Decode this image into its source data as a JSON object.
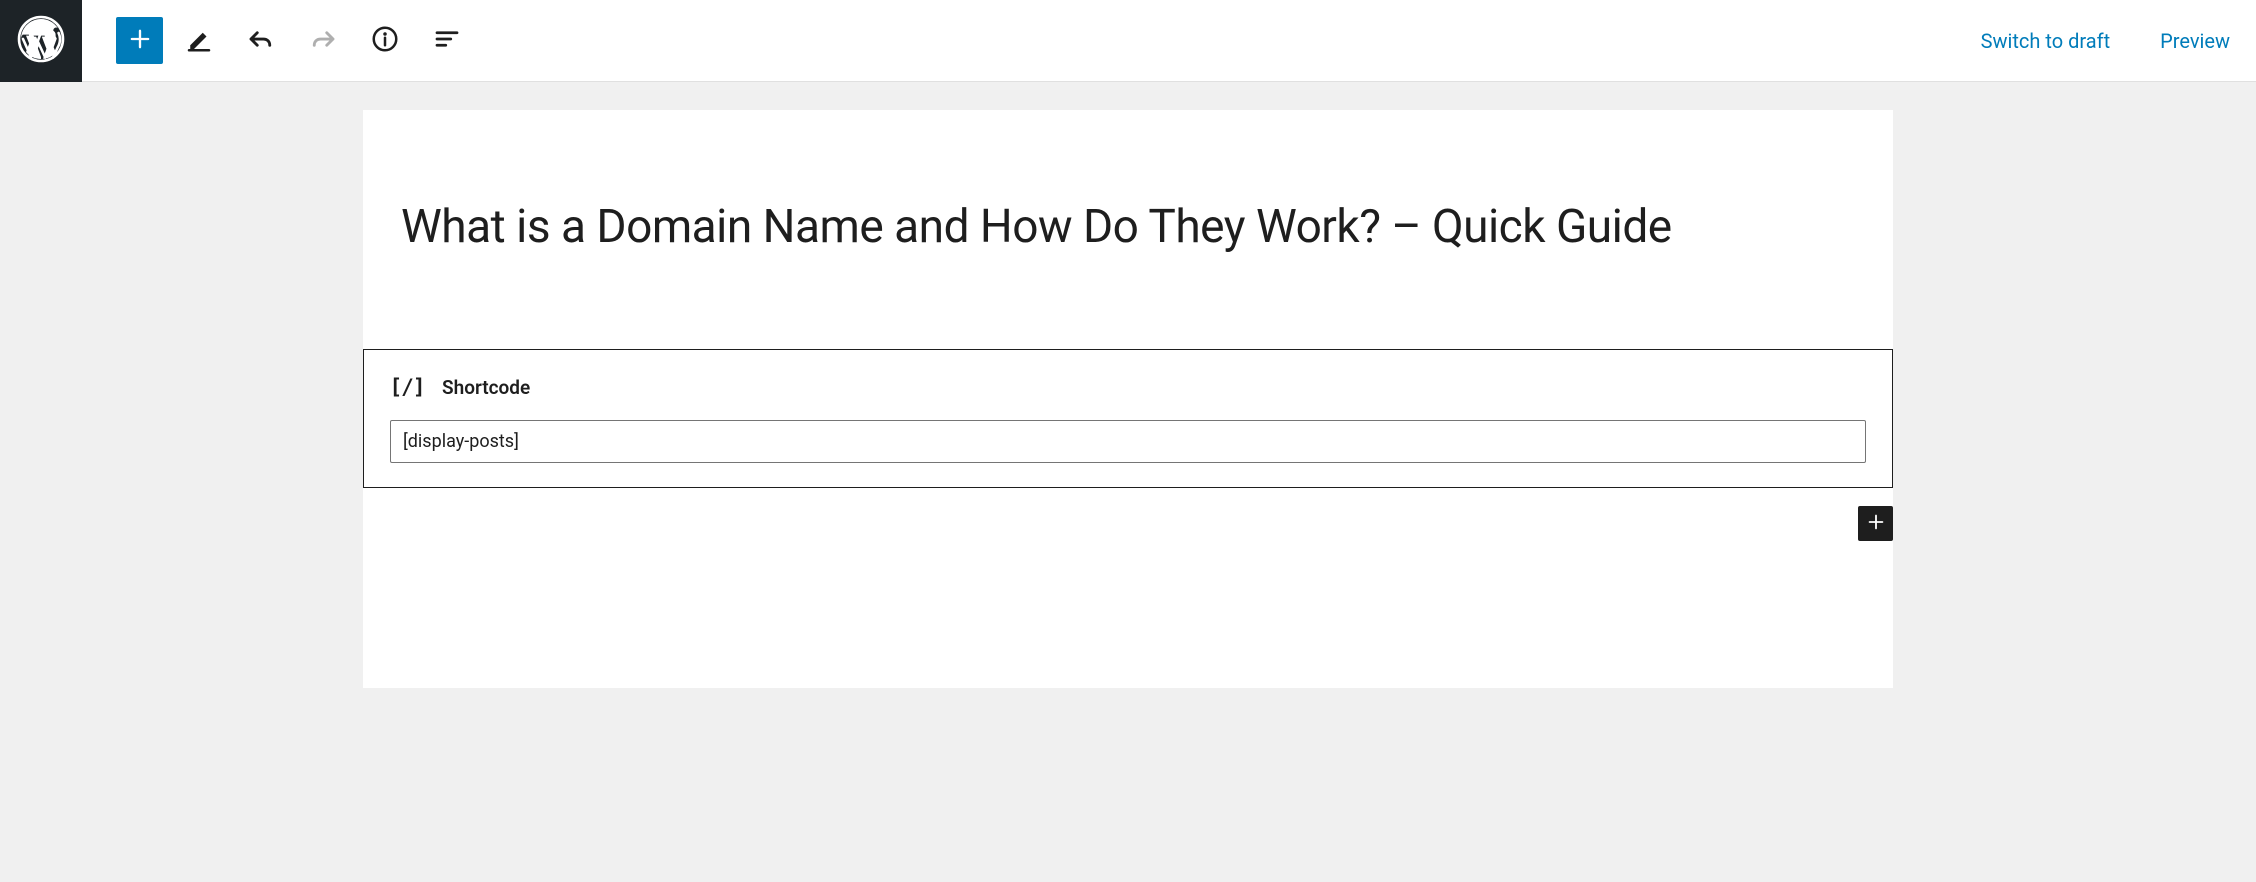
{
  "header": {
    "switch_to_draft": "Switch to draft",
    "preview": "Preview"
  },
  "editor": {
    "title": "What is a Domain Name and How Do They Work? – Quick Guide",
    "shortcode_block": {
      "label": "Shortcode",
      "value": "[display-posts]"
    }
  }
}
